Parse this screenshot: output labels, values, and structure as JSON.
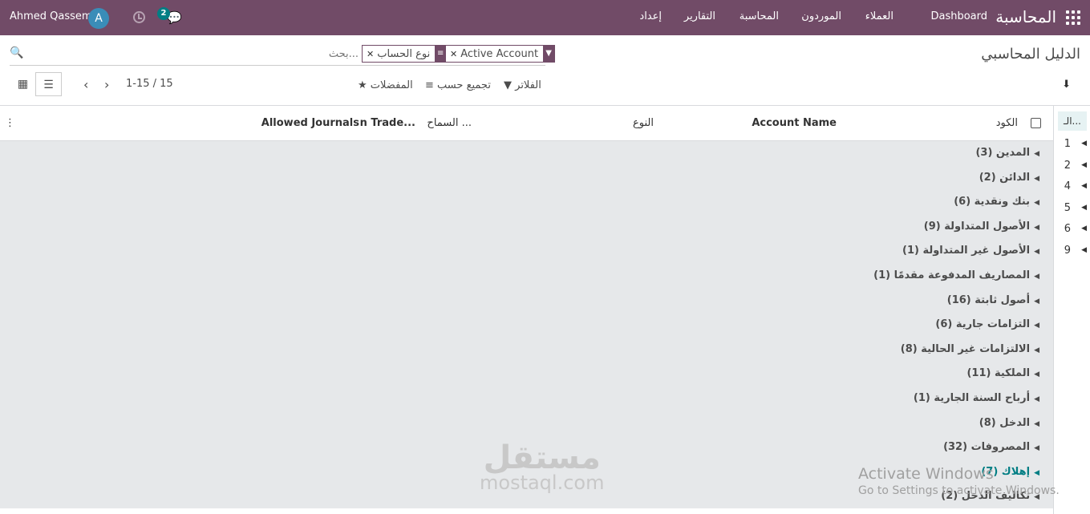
{
  "topbar": {
    "brand": "المحاسبة",
    "menu": [
      "Dashboard",
      "العملاء",
      "الموردون",
      "المحاسبة",
      "التقارير",
      "إعداد"
    ],
    "user_name": "Ahmed Qassem",
    "avatar_initial": "A",
    "message_count": "2"
  },
  "control": {
    "title": "الدليل المحاسبي",
    "search_placeholder": "بحث...",
    "facets": [
      "Active Account",
      "نوع الحساب"
    ],
    "filters_label": "الفلاتر",
    "groupby_label": "تجميع حسب",
    "favorites_label": "المفضلات",
    "pager": "1-15 / 15"
  },
  "table": {
    "headers": {
      "code": "الكود",
      "name": "Account Name",
      "type": "النوع",
      "reconcile": "السماح ...",
      "trade": "n Trade...",
      "journals": "Allowed Journals"
    },
    "groups": [
      {
        "label": "المدين (3)"
      },
      {
        "label": "الدائن (2)"
      },
      {
        "label": "بنك ونقدية (6)"
      },
      {
        "label": "الأصول المتداولة (9)"
      },
      {
        "label": "الأصول غير المتداولة (1)"
      },
      {
        "label": "المصاريف المدفوعة مقدمًا (1)"
      },
      {
        "label": "أصول ثابتة (16)"
      },
      {
        "label": "التزامات جارية (6)"
      },
      {
        "label": "الالتزامات غير الحالية (8)"
      },
      {
        "label": "الملكية (11)"
      },
      {
        "label": "أرباح السنة الجارية (1)"
      },
      {
        "label": "الدخل (8)"
      },
      {
        "label": "المصروفات (32)"
      },
      {
        "label": "إهلاك (7)"
      },
      {
        "label": "تكاليف الدخل (2)"
      }
    ]
  },
  "sidepanel": {
    "header": "الـ...",
    "items": [
      "1",
      "2",
      "4",
      "5",
      "6",
      "9"
    ]
  },
  "watermark": {
    "line1": "Activate Windows",
    "line2": "Go to Settings to activate Windows.",
    "logo_ar": "مستقل",
    "logo_en": "mostaql.com"
  },
  "colors": {
    "brand": "#714b67",
    "teal": "#017e84",
    "group_bg": "#e6e8ea"
  },
  "icons": [
    "apps-grid-icon",
    "clock-icon",
    "chat-icon",
    "search-icon",
    "filter-icon",
    "group-icon",
    "star-icon",
    "download-icon",
    "kanban-icon",
    "list-icon",
    "caret-icon"
  ]
}
